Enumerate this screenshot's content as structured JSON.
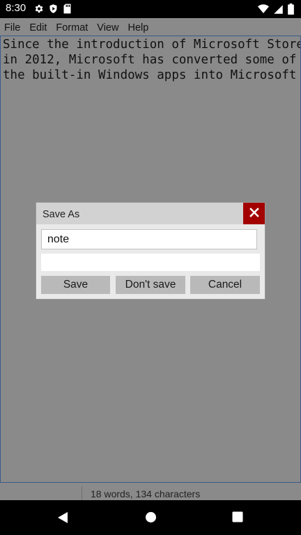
{
  "status_bar": {
    "time": "8:30",
    "left_icons": [
      "gear-icon",
      "shield-play-icon",
      "sd-card-icon"
    ],
    "right_icons": [
      "wifi-icon",
      "signal-icon",
      "battery-icon"
    ]
  },
  "menu": {
    "items": [
      {
        "label": "File"
      },
      {
        "label": "Edit"
      },
      {
        "label": "Format"
      },
      {
        "label": "View"
      },
      {
        "label": "Help"
      }
    ]
  },
  "editor": {
    "text": "Since the introduction of Microsoft Store\nin 2012, Microsoft has converted some of\nthe built-in Windows apps into Microsoft"
  },
  "footer": {
    "counts": "18 words, 134 characters"
  },
  "dialog": {
    "title": "Save As",
    "filename_value": "note",
    "buttons": {
      "save": "Save",
      "dont_save": "Don't save",
      "cancel": "Cancel"
    },
    "close_color": "#a30000"
  },
  "nav_bar": {
    "icons": [
      "back-icon",
      "home-icon",
      "recents-icon"
    ]
  }
}
